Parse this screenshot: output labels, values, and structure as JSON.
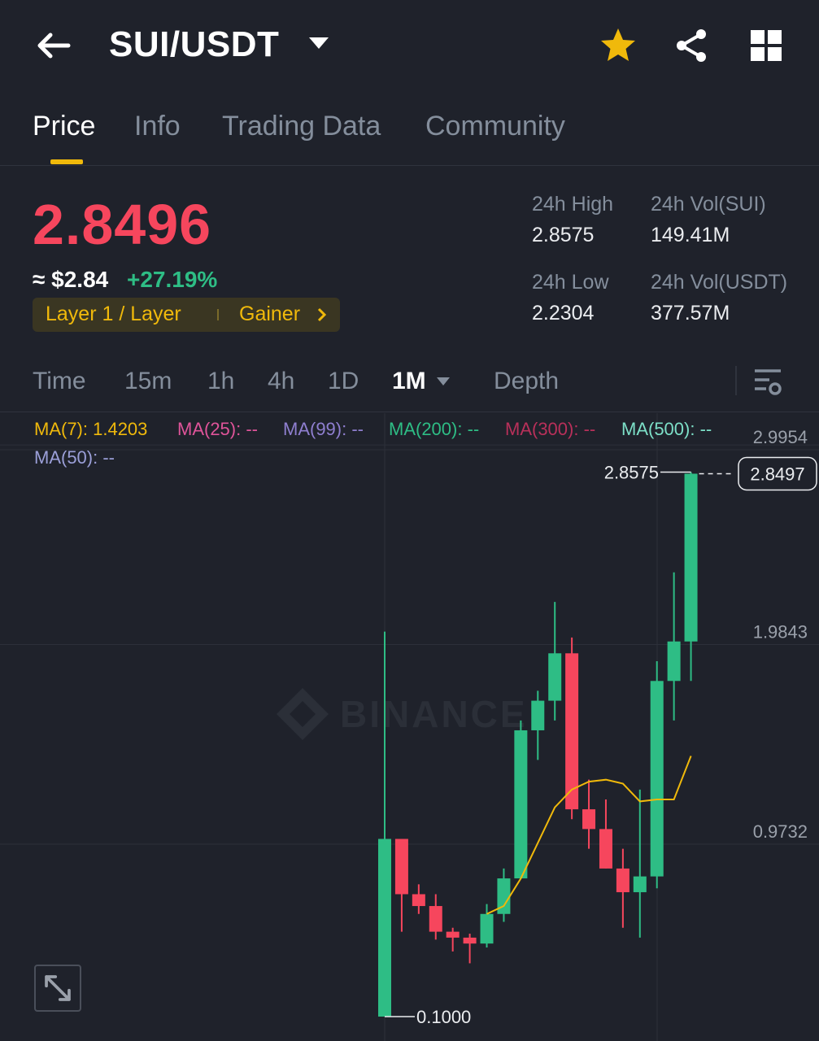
{
  "header": {
    "pair": "SUI/USDT",
    "icons": [
      "arrow-left-icon",
      "caret-down-icon",
      "star-icon",
      "share-icon",
      "grid-icon"
    ],
    "star_color": "#f0b90b"
  },
  "tabs": [
    {
      "label": "Price",
      "active": true
    },
    {
      "label": "Info",
      "active": false
    },
    {
      "label": "Trading Data",
      "active": false
    },
    {
      "label": "Community",
      "active": false
    }
  ],
  "ticker": {
    "price": "2.8496",
    "approx_usd": "≈ $2.84",
    "change_pct": "+27.19%",
    "tag_category": "Layer 1 / Layer",
    "tag_gainer": "Gainer",
    "down_color": "#f6465d",
    "up_color": "#2ebd85"
  },
  "stats": {
    "high_label": "24h High",
    "high_value": "2.8575",
    "low_label": "24h Low",
    "low_value": "2.2304",
    "vol_base_label": "24h Vol(SUI)",
    "vol_base_value": "149.41M",
    "vol_quote_label": "24h Vol(USDT)",
    "vol_quote_value": "377.57M"
  },
  "timeframes": [
    "Time",
    "15m",
    "1h",
    "4h",
    "1D",
    "1M",
    "Depth"
  ],
  "selected_timeframe": "1M",
  "indicators": [
    {
      "text": "MA(7): 1.4203",
      "color": "#f0b90b"
    },
    {
      "text": "MA(25): --",
      "color": "#e0549a"
    },
    {
      "text": "MA(99): --",
      "color": "#8f7fd0"
    },
    {
      "text": "MA(200): --",
      "color": "#2ebd85"
    },
    {
      "text": "MA(300): --",
      "color": "#b8305a"
    },
    {
      "text": "MA(500): --",
      "color": "#7de0c8"
    },
    {
      "text": "MA(50): --",
      "color": "#9b9fd8"
    }
  ],
  "watermark": "BINANCE",
  "chart_data": {
    "type": "candlestick",
    "y_ticks": [
      "2.9954",
      "1.9843",
      "0.9732"
    ],
    "y_tick_values": [
      2.9954,
      1.9843,
      0.9732
    ],
    "high_label": "2.8575",
    "low_label": "0.1000",
    "last_price_label": "2.8497",
    "last_price": 2.8497,
    "candles": [
      {
        "o": 0.1,
        "h": 2.05,
        "l": 0.1,
        "c": 1.0
      },
      {
        "o": 1.0,
        "h": 1.0,
        "l": 0.53,
        "c": 0.72
      },
      {
        "o": 0.72,
        "h": 0.77,
        "l": 0.62,
        "c": 0.66
      },
      {
        "o": 0.66,
        "h": 0.72,
        "l": 0.49,
        "c": 0.53
      },
      {
        "o": 0.53,
        "h": 0.55,
        "l": 0.43,
        "c": 0.5
      },
      {
        "o": 0.5,
        "h": 0.52,
        "l": 0.37,
        "c": 0.47
      },
      {
        "o": 0.47,
        "h": 0.67,
        "l": 0.45,
        "c": 0.62
      },
      {
        "o": 0.62,
        "h": 0.85,
        "l": 0.58,
        "c": 0.8
      },
      {
        "o": 0.8,
        "h": 1.6,
        "l": 0.8,
        "c": 1.55
      },
      {
        "o": 1.55,
        "h": 1.75,
        "l": 1.4,
        "c": 1.7
      },
      {
        "o": 1.7,
        "h": 2.2,
        "l": 1.6,
        "c": 1.94
      },
      {
        "o": 1.94,
        "h": 2.02,
        "l": 1.1,
        "c": 1.15
      },
      {
        "o": 1.15,
        "h": 1.3,
        "l": 0.95,
        "c": 1.05
      },
      {
        "o": 1.05,
        "h": 1.2,
        "l": 0.85,
        "c": 0.85
      },
      {
        "o": 0.85,
        "h": 0.95,
        "l": 0.55,
        "c": 0.73
      },
      {
        "o": 0.73,
        "h": 1.25,
        "l": 0.5,
        "c": 0.81
      },
      {
        "o": 0.81,
        "h": 1.9,
        "l": 0.75,
        "c": 1.8
      },
      {
        "o": 1.8,
        "h": 2.35,
        "l": 1.6,
        "c": 2.0
      },
      {
        "o": 2.0,
        "h": 2.8575,
        "l": 1.8,
        "c": 2.8497
      }
    ],
    "ma7": [
      null,
      null,
      null,
      null,
      null,
      null,
      0.62,
      0.66,
      0.8,
      0.98,
      1.16,
      1.25,
      1.29,
      1.3,
      1.28,
      1.19,
      1.2,
      1.2,
      1.42
    ]
  }
}
